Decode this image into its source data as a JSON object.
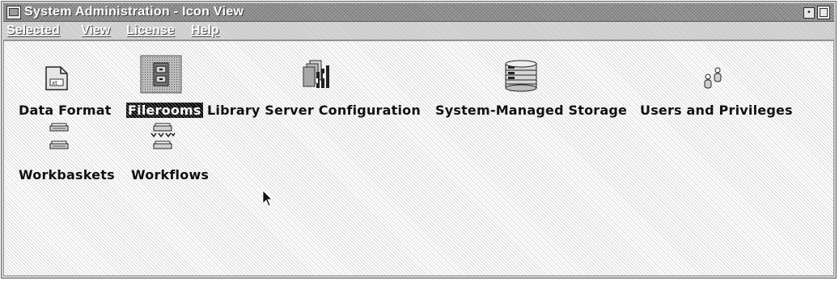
{
  "window": {
    "title": "System Administration - Icon View"
  },
  "menu": {
    "items": [
      {
        "label": "Selected"
      },
      {
        "label": "View"
      },
      {
        "label": "License"
      },
      {
        "label": "Help"
      }
    ]
  },
  "icons": [
    {
      "label": "Data Format",
      "icon": "document-icon",
      "selected": false
    },
    {
      "label": "Filerooms",
      "icon": "fileroom-cabinet-icon",
      "selected": true
    },
    {
      "label": "Library Server Configuration",
      "icon": "library-server-icon",
      "selected": false
    },
    {
      "label": "System-Managed Storage",
      "icon": "storage-drum-icon",
      "selected": false
    },
    {
      "label": "Users and Privileges",
      "icon": "users-icon",
      "selected": false
    },
    {
      "label": "Workbaskets",
      "icon": "workbasket-trays-icon",
      "selected": false
    },
    {
      "label": "Workflows",
      "icon": "workflow-trays-icon",
      "selected": false
    }
  ],
  "colors": {
    "titlebar": "#8f8f8f",
    "window_bg": "#cfcfcf",
    "label_text": "#111111",
    "selection": "#000000"
  }
}
